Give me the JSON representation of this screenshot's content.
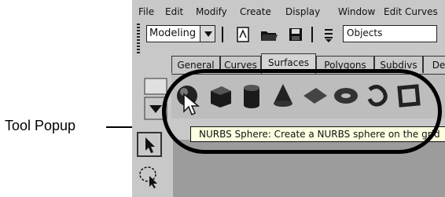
{
  "menubar": {
    "items": [
      "File",
      "Edit",
      "Modify",
      "Create",
      "Display",
      "Window",
      "Edit Curves"
    ]
  },
  "statusline": {
    "mode_select": "Modeling",
    "selection_mode_field": "Objects",
    "icons": [
      "new-scene-icon",
      "open-scene-icon",
      "save-scene-icon",
      "selection-mask-icon"
    ]
  },
  "shelf": {
    "tabs": [
      "General",
      "Curves",
      "Surfaces",
      "Polygons",
      "Subdivs",
      "De"
    ],
    "active_tab": "Surfaces",
    "tools": [
      "nurbs-sphere-icon",
      "nurbs-cube-icon",
      "nurbs-cylinder-icon",
      "nurbs-cone-icon",
      "nurbs-plane-icon",
      "nurbs-torus-icon",
      "nurbs-circle-icon",
      "nurbs-square-icon"
    ]
  },
  "tooltip": {
    "text": "NURBS Sphere: Create a NURBS sphere on the grid"
  },
  "toolbox": {
    "tools": [
      "select-tool-icon",
      "lasso-tool-icon"
    ]
  },
  "annotation": {
    "label": "Tool Popup"
  },
  "colors": {
    "ui_gray": "#c8c8c8",
    "tooltip_bg": "#ffffe1",
    "viewport_gray": "#9c9c9c"
  }
}
